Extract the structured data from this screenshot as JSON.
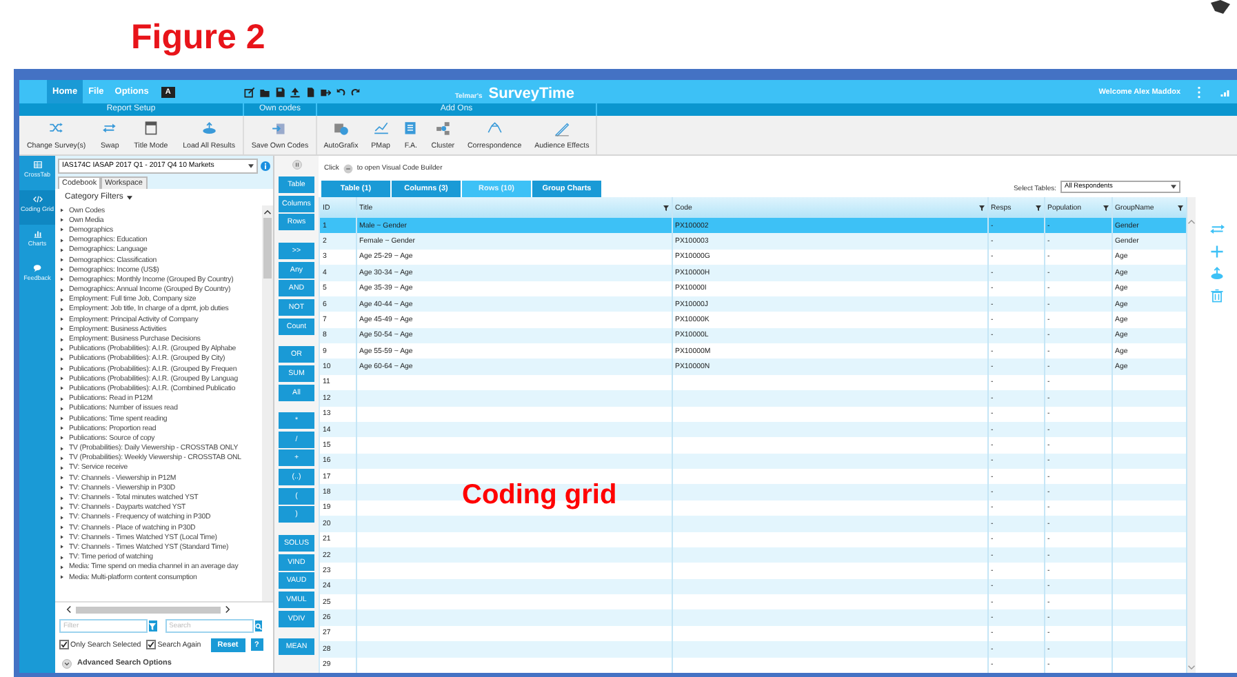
{
  "figure_title": "Figure 2",
  "menu_tabs": [
    {
      "label": "Home",
      "selected": true
    },
    {
      "label": "File",
      "selected": false
    },
    {
      "label": "Options",
      "selected": false
    }
  ],
  "menu_badge": "A",
  "logo": {
    "prefix": "Telmar's",
    "name": "SurveyTime"
  },
  "welcome": "Welcome Alex Maddox",
  "ribbon_groups": [
    {
      "title": "Report Setup",
      "buttons": [
        "Change Survey(s)",
        "Swap",
        "Title Mode",
        "Load All Results"
      ]
    },
    {
      "title": "Own codes",
      "buttons": [
        "Save Own Codes"
      ]
    },
    {
      "title": "Add Ons",
      "buttons": [
        "AutoGrafix",
        "PMap",
        "F.A.",
        "Cluster",
        "Correspondence",
        "Audience Effects"
      ]
    }
  ],
  "nav": [
    {
      "label": "CrossTab",
      "selected": false
    },
    {
      "label": "Coding Grid",
      "selected": true
    },
    {
      "label": "Charts",
      "selected": false
    },
    {
      "label": "Feedback",
      "selected": false
    }
  ],
  "survey": "IAS174C IASAP 2017 Q1 - 2017 Q4 10 Markets",
  "panel_tabs": [
    {
      "label": "Codebook",
      "selected": true
    },
    {
      "label": "Workspace",
      "selected": false
    }
  ],
  "category_filters": "Category Filters",
  "categories": [
    "Own Codes",
    "Own Media",
    "Demographics",
    "Demographics: Education",
    "Demographics: Language",
    "Demographics: Classification",
    "Demographics: Income (US$)",
    "Demographics: Monthly Income (Grouped By Country)",
    "Demographics: Annual Income (Grouped By Country)",
    "Employment: Full time Job, Company size",
    "Employment: Job title, In charge of a dpmt, job duties",
    "Employment: Principal Activity of Company",
    "Employment: Business Activities",
    "Employment: Business Purchase Decisions",
    "Publications (Probabilities): A.I.R. (Grouped By Alphabe",
    "Publications (Probabilities): A.I.R. (Grouped By City)",
    "Publications (Probabilities): A.I.R. (Grouped By Frequen",
    "Publications (Probabilities): A.I.R. (Grouped By Languag",
    "Publications (Probabilities): A.I.R. (Combined Publicatio",
    "Publications: Read in P12M",
    "Publications: Number of issues read",
    "Publications: Time spent reading",
    "Publications: Proportion read",
    "Publications: Source of copy",
    "TV (Probabilities): Daily Viewership - CROSSTAB ONLY",
    "TV (Probabilities): Weekly Viewership - CROSSTAB ONL",
    "TV: Service receive",
    "TV: Channels - Viewership in P12M",
    "TV: Channels - Viewership in P30D",
    "TV: Channels - Total minutes watched YST",
    "TV: Channels - Dayparts watched YST",
    "TV: Channels - Frequency of watching in P30D",
    "TV: Channels - Place of watching in P30D",
    "TV: Channels - Times Watched YST (Local Time)",
    "TV: Channels - Times Watched YST (Standard Time)",
    "TV: Time period of watching",
    "Media: Time spend on media channel in an average day",
    "Media: Multi-platform content consumption"
  ],
  "filter": {
    "placeholder": "Filter"
  },
  "search": {
    "placeholder": "Search"
  },
  "options": [
    {
      "label": "Only Search Selected",
      "checked": true
    },
    {
      "label": "Search Again",
      "checked": true
    }
  ],
  "reset_button": "Reset",
  "help_button": "?",
  "advanced_search": "Advanced Search Options",
  "operator_groups": [
    [
      "Table",
      "Columns",
      "Rows"
    ],
    [
      ">>",
      "Any",
      "AND",
      "NOT",
      "Count"
    ],
    [
      "OR",
      "SUM",
      "All"
    ],
    [
      "*",
      "/",
      "+",
      "(..)",
      "(",
      ")"
    ],
    [
      "SOLUS",
      "VIND",
      "VAUD",
      "VMUL",
      "VDIV"
    ],
    [
      "MEAN"
    ]
  ],
  "hint": {
    "before": "Click",
    "after": "to open Visual Code Builder"
  },
  "grid_tabs": [
    {
      "label": "Table (1)",
      "selected": false
    },
    {
      "label": "Columns (3)",
      "selected": false
    },
    {
      "label": "Rows (10)",
      "selected": true
    },
    {
      "label": "Group Charts",
      "selected": false
    }
  ],
  "select_tables": {
    "label": "Select Tables:",
    "value": "All Respondents"
  },
  "grid": {
    "columns": [
      {
        "label": "ID",
        "filter": false
      },
      {
        "label": "Title",
        "filter": true
      },
      {
        "label": "Code",
        "filter": true
      },
      {
        "label": "Resps",
        "filter": true
      },
      {
        "label": "Population",
        "filter": true
      },
      {
        "label": "GroupName",
        "filter": true
      }
    ],
    "rows": [
      {
        "id": "1",
        "title": "Male ~ Gender",
        "code": "PX100002",
        "resps": "-",
        "population": "-",
        "group": "Gender",
        "selected": true
      },
      {
        "id": "2",
        "title": "Female ~ Gender",
        "code": "PX100003",
        "resps": "-",
        "population": "-",
        "group": "Gender",
        "selected": false
      },
      {
        "id": "3",
        "title": "Age 25-29 ~ Age",
        "code": "PX10000G",
        "resps": "-",
        "population": "-",
        "group": "Age",
        "selected": false
      },
      {
        "id": "4",
        "title": "Age 30-34 ~ Age",
        "code": "PX10000H",
        "resps": "-",
        "population": "-",
        "group": "Age",
        "selected": false
      },
      {
        "id": "5",
        "title": "Age 35-39 ~ Age",
        "code": "PX10000I",
        "resps": "-",
        "population": "-",
        "group": "Age",
        "selected": false
      },
      {
        "id": "6",
        "title": "Age 40-44 ~ Age",
        "code": "PX10000J",
        "resps": "-",
        "population": "-",
        "group": "Age",
        "selected": false
      },
      {
        "id": "7",
        "title": "Age 45-49 ~ Age",
        "code": "PX10000K",
        "resps": "-",
        "population": "-",
        "group": "Age",
        "selected": false
      },
      {
        "id": "8",
        "title": "Age 50-54 ~ Age",
        "code": "PX10000L",
        "resps": "-",
        "population": "-",
        "group": "Age",
        "selected": false
      },
      {
        "id": "9",
        "title": "Age 55-59 ~ Age",
        "code": "PX10000M",
        "resps": "-",
        "population": "-",
        "group": "Age",
        "selected": false
      },
      {
        "id": "10",
        "title": "Age 60-64 ~ Age",
        "code": "PX10000N",
        "resps": "-",
        "population": "-",
        "group": "Age",
        "selected": false
      },
      {
        "id": "11",
        "resps": "-",
        "population": "-",
        "selected": false
      },
      {
        "id": "12",
        "resps": "-",
        "population": "-",
        "selected": false
      },
      {
        "id": "13",
        "resps": "-",
        "population": "-",
        "selected": false
      },
      {
        "id": "14",
        "resps": "-",
        "population": "-",
        "selected": false
      },
      {
        "id": "15",
        "resps": "-",
        "population": "-",
        "selected": false
      },
      {
        "id": "16",
        "resps": "-",
        "population": "-",
        "selected": false
      },
      {
        "id": "17",
        "resps": "-",
        "population": "-",
        "selected": false
      },
      {
        "id": "18",
        "resps": "-",
        "population": "-",
        "selected": false
      },
      {
        "id": "19",
        "resps": "-",
        "population": "-",
        "selected": false
      },
      {
        "id": "20",
        "resps": "-",
        "population": "-",
        "selected": false
      },
      {
        "id": "21",
        "resps": "-",
        "population": "-",
        "selected": false
      },
      {
        "id": "22",
        "resps": "-",
        "population": "-",
        "selected": false
      },
      {
        "id": "23",
        "resps": "-",
        "population": "-",
        "selected": false
      },
      {
        "id": "24",
        "resps": "-",
        "population": "-",
        "selected": false
      },
      {
        "id": "25",
        "resps": "-",
        "population": "-",
        "selected": false
      },
      {
        "id": "26",
        "resps": "-",
        "population": "-",
        "selected": false
      },
      {
        "id": "27",
        "resps": "-",
        "population": "-",
        "selected": false
      },
      {
        "id": "28",
        "resps": "-",
        "population": "-",
        "selected": false
      },
      {
        "id": "29",
        "resps": "-",
        "population": "-",
        "selected": false
      }
    ]
  },
  "overlay_caption": "Coding grid"
}
